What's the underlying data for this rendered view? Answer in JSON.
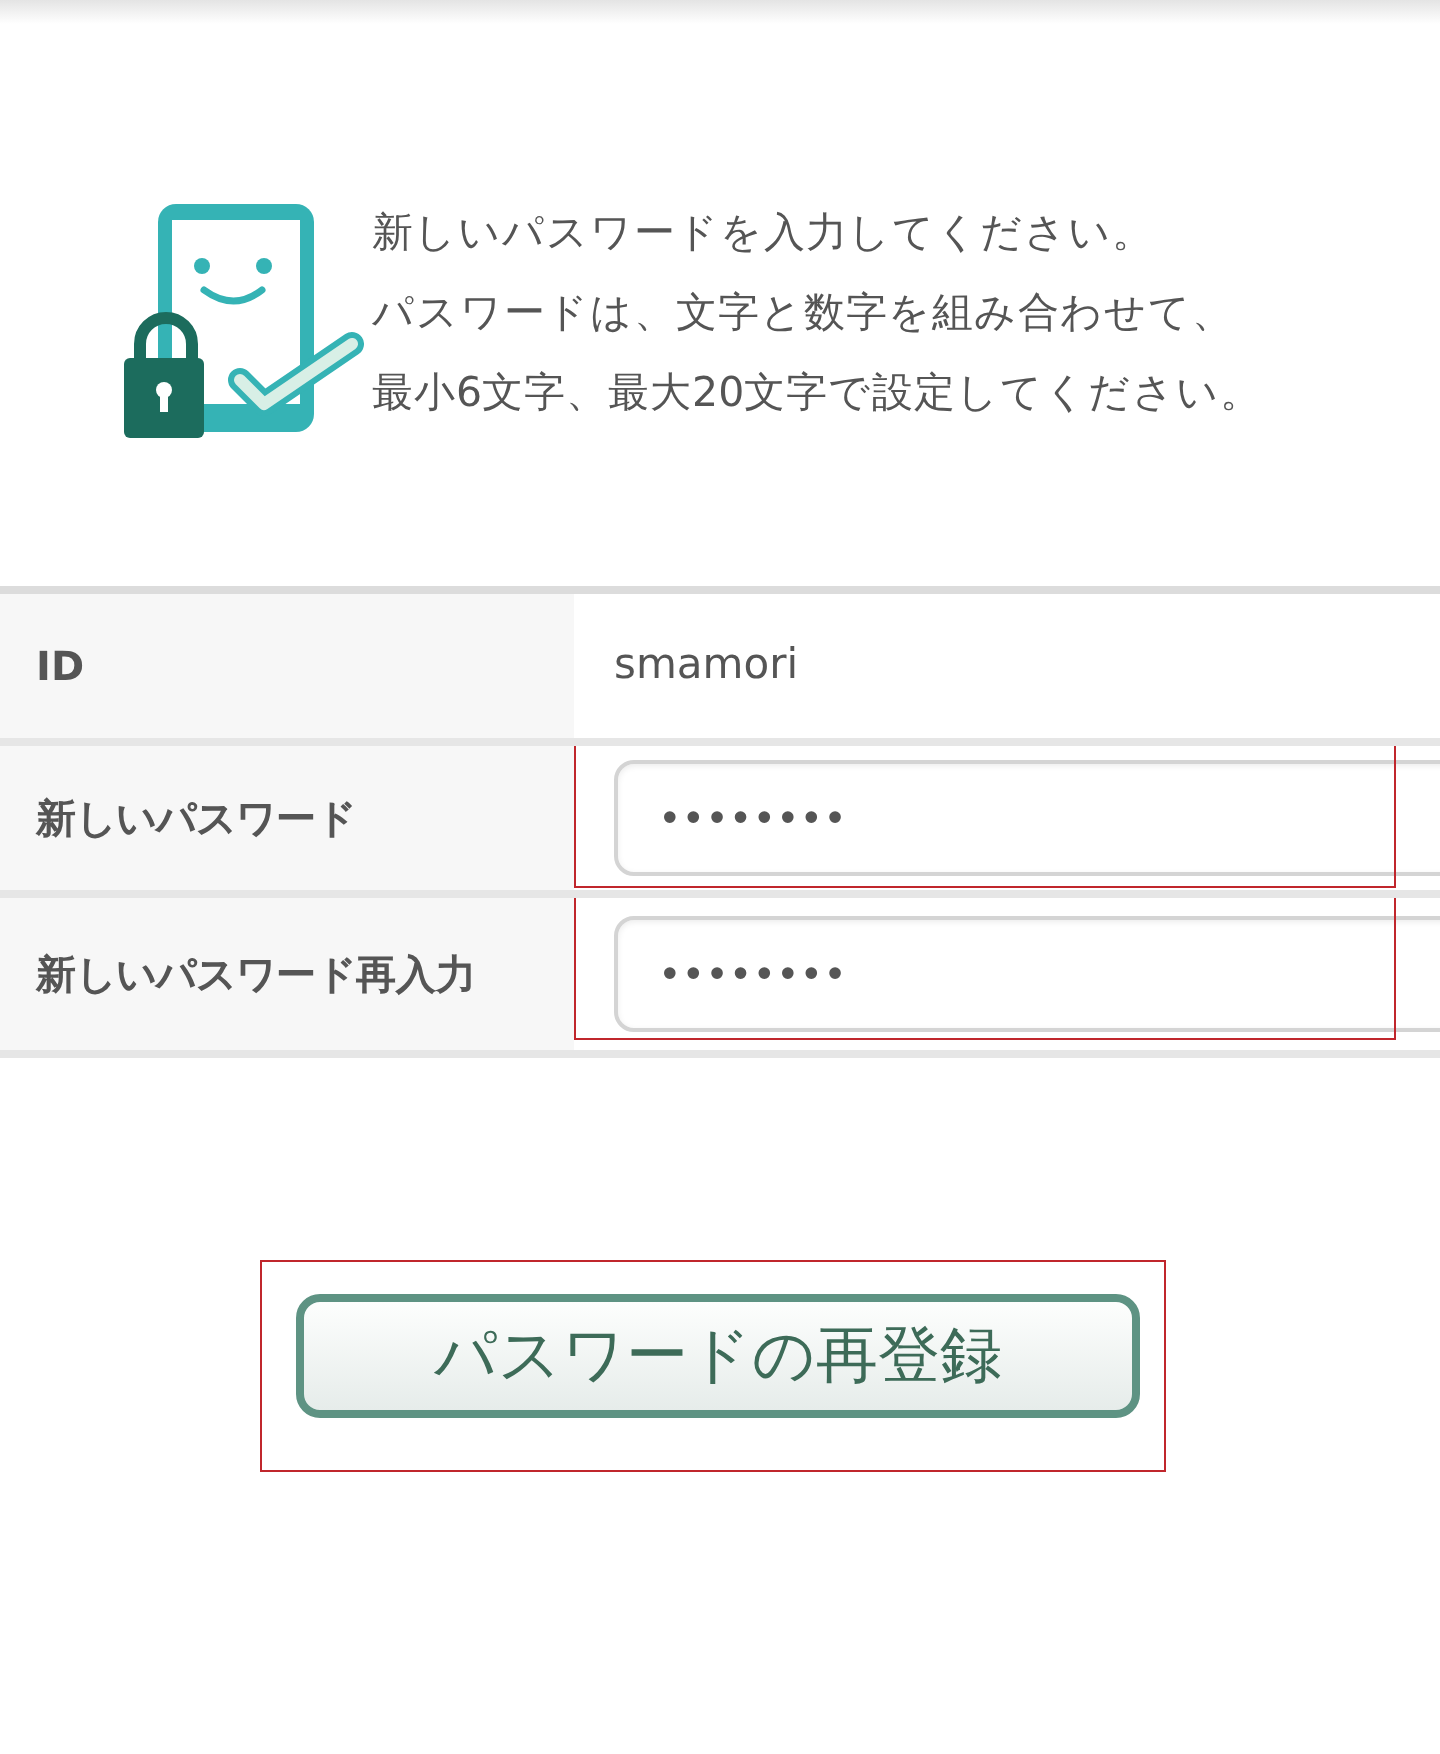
{
  "intro": {
    "lines": [
      "新しいパスワードを入力してください。",
      "パスワードは、文字と数字を組み合わせて、",
      "最小6文字、最大20文字で設定してください。"
    ]
  },
  "form": {
    "rows": [
      {
        "kind": "text",
        "label": "ID",
        "value": "smamori"
      },
      {
        "kind": "password",
        "label": "新しいパスワード",
        "value": "••••••••",
        "highlighted": true
      },
      {
        "kind": "password",
        "label": "新しいパスワード再入力",
        "value": "••••••••",
        "highlighted": true
      }
    ]
  },
  "submit_button": {
    "label": "パスワードの再登録",
    "highlighted": true
  }
}
